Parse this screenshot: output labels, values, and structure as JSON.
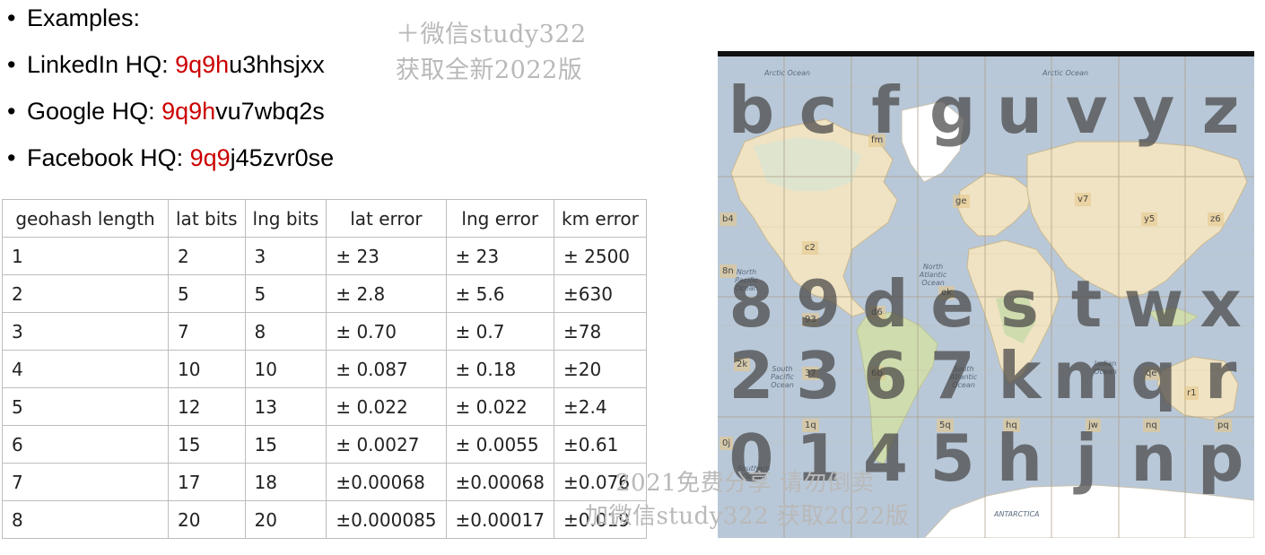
{
  "bullets": [
    {
      "prefix": "Examples:",
      "highlight": "",
      "rest": ""
    },
    {
      "prefix": "LinkedIn HQ: ",
      "highlight": "9q9h",
      "rest": "u3hhsjxx"
    },
    {
      "prefix": "Google HQ: ",
      "highlight": "9q9h",
      "rest": "vu7wbq2s"
    },
    {
      "prefix": "Facebook HQ: ",
      "highlight": "9q9",
      "rest": "j45zvr0se"
    }
  ],
  "bullet_char": "•",
  "watermarks": {
    "top_line1": "＋微信study322",
    "top_line2": "获取全新2022版",
    "bottom_line1": "2021免费分享 请勿倒卖",
    "bottom_line2": "加微信study322 获取2022版"
  },
  "table": {
    "headers": [
      "geohash length",
      "lat bits",
      "lng bits",
      "lat error",
      "lng error",
      "km error"
    ],
    "rows": [
      [
        "1",
        "2",
        "3",
        "± 23",
        "± 23",
        "± 2500"
      ],
      [
        "2",
        "5",
        "5",
        "± 2.8",
        "± 5.6",
        "±630"
      ],
      [
        "3",
        "7",
        "8",
        "± 0.70",
        "± 0.7",
        "±78"
      ],
      [
        "4",
        "10",
        "10",
        "± 0.087",
        "± 0.18",
        "±20"
      ],
      [
        "5",
        "12",
        "13",
        "± 0.022",
        "± 0.022",
        "±2.4"
      ],
      [
        "6",
        "15",
        "15",
        "± 0.0027",
        "± 0.0055",
        "±0.61"
      ],
      [
        "7",
        "17",
        "18",
        "±0.00068",
        "±0.00068",
        "±0.076"
      ],
      [
        "8",
        "20",
        "20",
        "±0.000085",
        "±0.00017",
        "±0.019"
      ]
    ]
  },
  "map": {
    "grid": [
      [
        "b",
        "c",
        "f",
        "g",
        "u",
        "v",
        "y",
        "z"
      ],
      [
        "8",
        "9",
        "d",
        "e",
        "s",
        "t",
        "w",
        "x"
      ],
      [
        "2",
        "3",
        "6",
        "7",
        "k",
        "m",
        "q",
        "r"
      ],
      [
        "0",
        "1",
        "4",
        "5",
        "h",
        "j",
        "n",
        "p"
      ]
    ],
    "tile_labels": [
      "b4",
      "c2",
      "fm",
      "ge",
      "v7",
      "y5",
      "z6",
      "8n",
      "93",
      "d6",
      "ek",
      "2k",
      "37",
      "6b",
      "1q",
      "5q",
      "hq",
      "jw",
      "nq",
      "pq",
      "0j",
      "r1",
      "qe"
    ],
    "ocean_labels": [
      "Arctic Ocean",
      "Arctic Ocean",
      "North Pacific Ocean",
      "North Atlantic Ocean",
      "South Pacific Ocean",
      "South Atlantic Ocean",
      "Indian Ocean",
      "Southern Ocean",
      "ANTARCTICA"
    ],
    "colors": {
      "ocean": "#b9c8d8",
      "land": "#efe3c3",
      "forest": "#cfdcae",
      "ice": "#ffffff",
      "letter": "#464646"
    }
  }
}
